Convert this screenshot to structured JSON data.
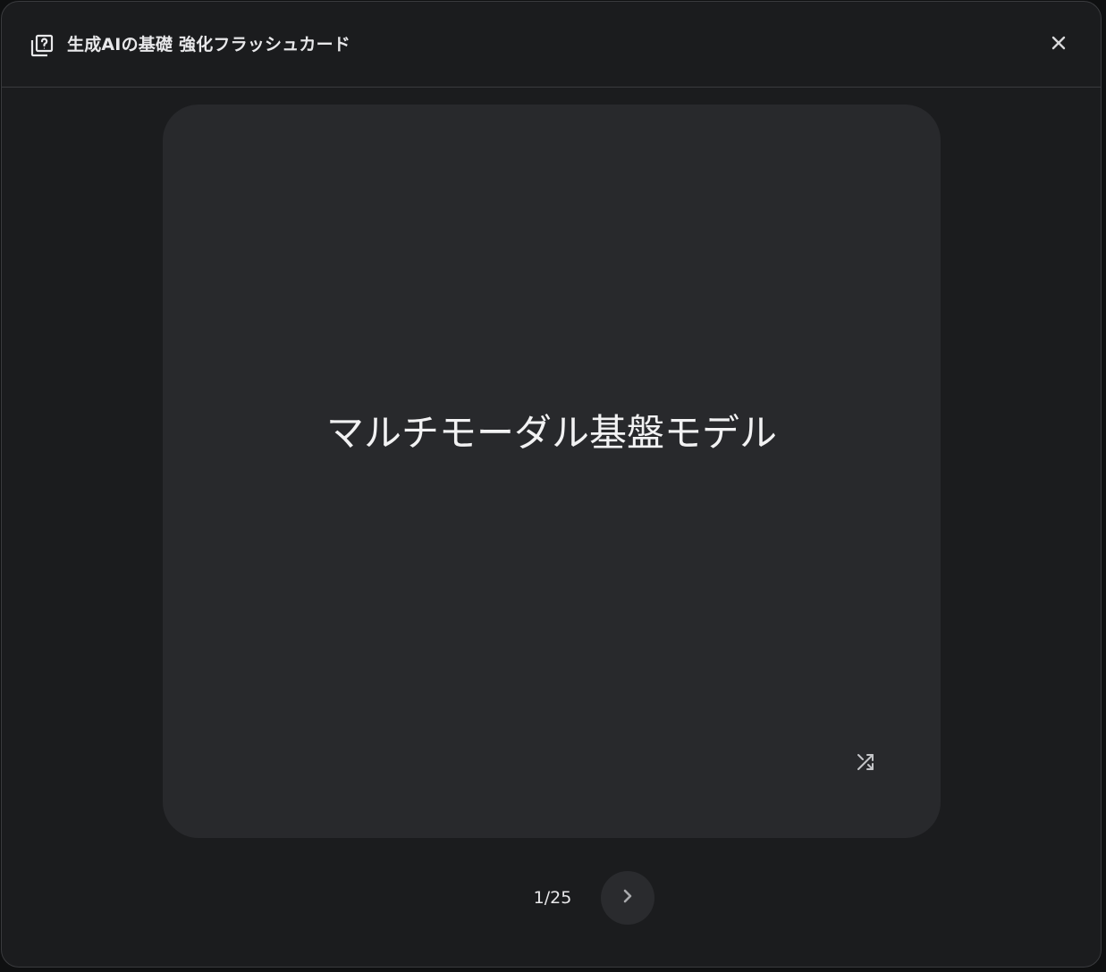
{
  "header": {
    "title": "生成AIの基礎 強化フラッシュカード",
    "icon": "flashcard-question-icon",
    "close_icon": "close-icon"
  },
  "card": {
    "term": "マルチモーダル基盤モデル",
    "shuffle_icon": "shuffle-icon"
  },
  "navigation": {
    "counter": "1/25",
    "next_icon": "chevron-right-icon"
  },
  "colors": {
    "background": "#1b1c1e",
    "card": "#28292c",
    "text": "#f2f2f3",
    "border": "#3a3b3e"
  }
}
